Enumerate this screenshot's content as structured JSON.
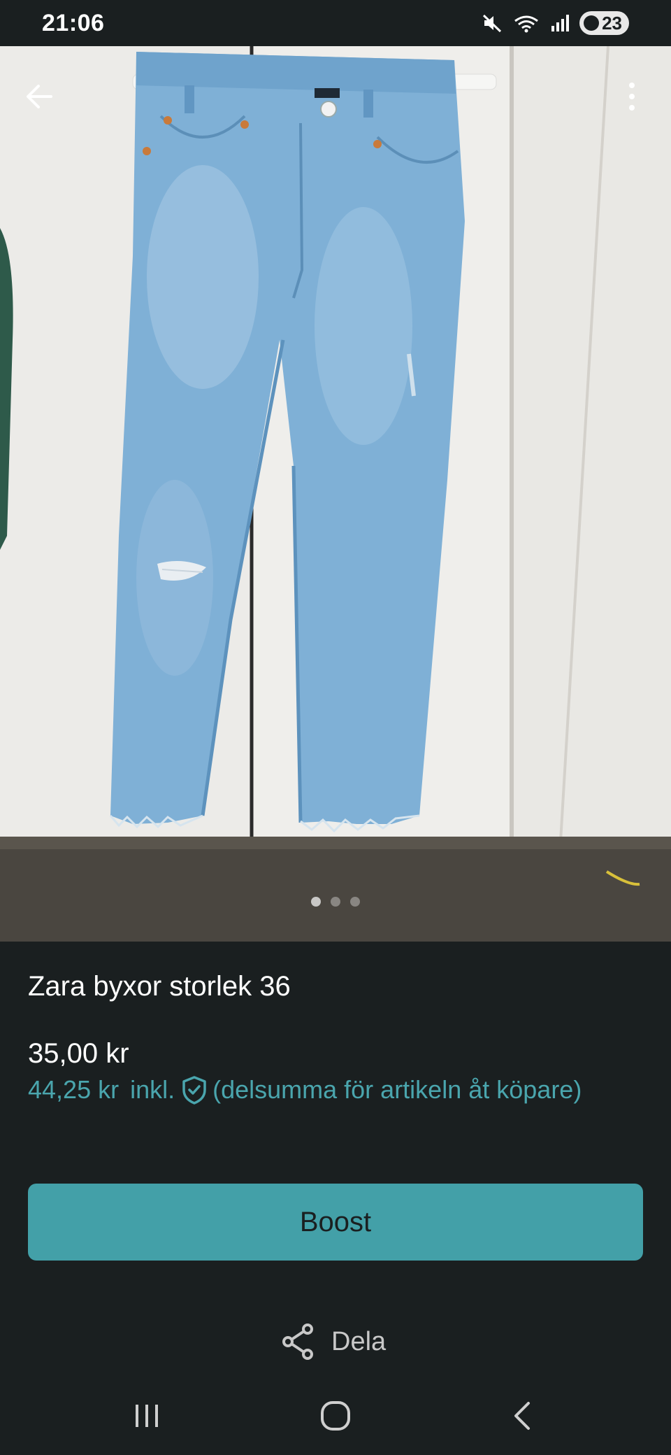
{
  "status_bar": {
    "time": "21:06",
    "battery": "23",
    "icons": [
      "mute-icon",
      "wifi-icon",
      "signal-icon"
    ]
  },
  "photo": {
    "icons": {
      "back": "back-arrow-icon",
      "more": "more-vertical-icon"
    },
    "page_dots": 3,
    "active_dot": 0
  },
  "listing": {
    "title": "Zara byxor storlek 36",
    "price": "35,00 kr",
    "price_incl": "44,25 kr",
    "incl_label": "inkl.",
    "incl_note": "(delsumma för artikeln åt köpare)"
  },
  "actions": {
    "boost_label": "Boost",
    "share_label": "Dela"
  },
  "colors": {
    "background": "#1a1f20",
    "accent": "#43a0a8",
    "accent_text": "#4aa5ad"
  }
}
